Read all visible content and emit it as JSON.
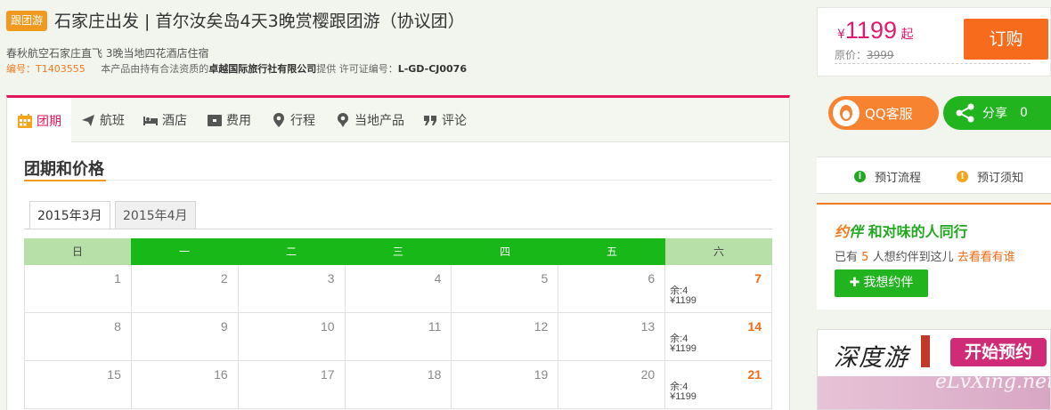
{
  "header": {
    "badge": "跟团游",
    "title": "石家庄出发 | 首尔汝矣岛4天3晚赏樱跟团游（协议团）",
    "subtitle": "春秋航空石家庄直飞 3晚当地四花酒店住宿",
    "meta": {
      "code_label": "编号：",
      "code": "T1403555",
      "provider_prefix": "本产品由持有合法资质的",
      "provider": "卓越国际旅行社有限公司",
      "provider_suffix": "提供 许可证编号：",
      "license": "L-GD-CJ0076"
    }
  },
  "price": {
    "currency": "¥",
    "amount": "1199",
    "suffix": "起",
    "original_label": "原价：",
    "original": "3999",
    "book_label": "订购"
  },
  "nav": {
    "tabs": [
      {
        "label": "团期",
        "icon": "calendar-icon"
      },
      {
        "label": "航班",
        "icon": "plane-icon"
      },
      {
        "label": "酒店",
        "icon": "bed-icon"
      },
      {
        "label": "费用",
        "icon": "wallet-icon"
      },
      {
        "label": "行程",
        "icon": "pin-icon"
      },
      {
        "label": "当地产品",
        "icon": "location-gear-icon"
      },
      {
        "label": "评论",
        "icon": "quote-icon"
      }
    ],
    "active": 0
  },
  "section": {
    "title": "团期和价格",
    "month_tabs": [
      "2015年3月",
      "2015年4月"
    ],
    "active_month": 0
  },
  "calendar": {
    "weekdays": [
      "日",
      "一",
      "二",
      "三",
      "四",
      "五",
      "六"
    ],
    "rows": [
      {
        "days": [
          "1",
          "2",
          "3",
          "4",
          "5",
          "6",
          "7"
        ],
        "sat": {
          "remain": "余:4",
          "price": "¥1199"
        }
      },
      {
        "days": [
          "8",
          "9",
          "10",
          "11",
          "12",
          "13",
          "14"
        ],
        "sat": {
          "remain": "余:4",
          "price": "¥1199"
        }
      },
      {
        "days": [
          "15",
          "16",
          "17",
          "18",
          "19",
          "20",
          "21"
        ],
        "sat": {
          "remain": "余:4",
          "price": "¥1199"
        }
      }
    ]
  },
  "side": {
    "qq_label": "QQ客服",
    "share_label": "分享",
    "share_count": "0",
    "process_label": "预订流程",
    "notice_label": "预订须知",
    "yue": {
      "logo_a": "约",
      "logo_b": "伴",
      "title": "和对味的人同行",
      "text_prefix": "已有",
      "count": "5",
      "text_mid": "人想约伴到这儿",
      "link": "去看看有谁",
      "button": "我想约伴"
    },
    "ad": {
      "logo": "深度游",
      "cta": "开始预约",
      "watermark": "eLvXing.net"
    }
  },
  "colors": {
    "accent_pink": "#e3165b",
    "book_orange": "#f76b1c",
    "calendar_green": "#18b818",
    "weekend_green": "#b7e0a9",
    "price_pink": "#e01a6e"
  }
}
